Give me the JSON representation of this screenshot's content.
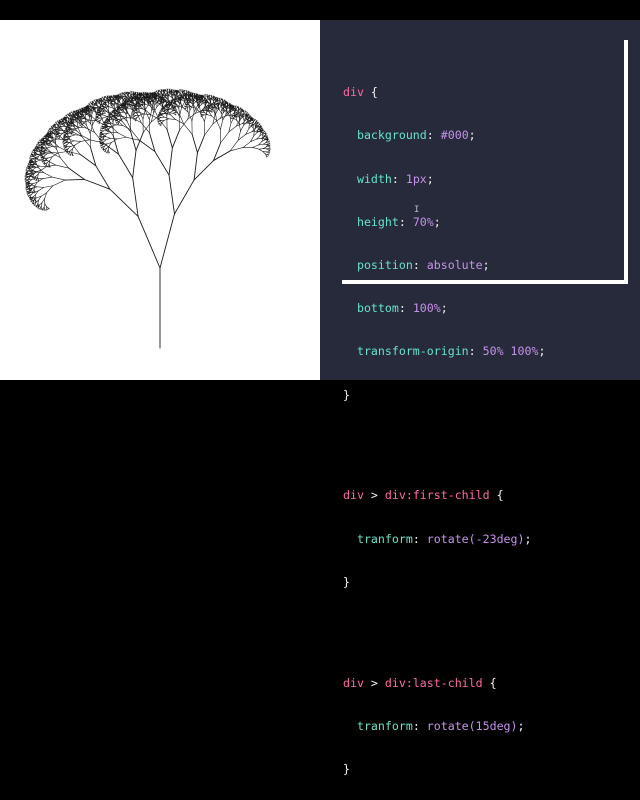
{
  "preview": {
    "tree": {
      "stroke": "#1a1a1a",
      "trunk_height_ratio": 0.7,
      "left_angle_deg": -23,
      "right_angle_deg": 15,
      "depth": 11
    }
  },
  "editor": {
    "theme": {
      "background": "#262a3a",
      "selector": "#ff6aa8",
      "property": "#67e3c8",
      "value": "#c792ea",
      "text": "#f2f2f2"
    },
    "rules": [
      {
        "selector": "div",
        "declarations": [
          {
            "property": "background",
            "value": "#000"
          },
          {
            "property": "width",
            "value": "1px"
          },
          {
            "property": "height",
            "value": "70%"
          },
          {
            "property": "position",
            "value": "absolute"
          },
          {
            "property": "bottom",
            "value": "100%"
          },
          {
            "property": "transform-origin",
            "value": "50% 100%"
          }
        ]
      },
      {
        "selector_parts": [
          "div",
          " > ",
          "div:first-child"
        ],
        "declarations": [
          {
            "property": "tranform",
            "value": "rotate(-23deg)"
          }
        ]
      },
      {
        "selector_parts": [
          "div",
          " > ",
          "div:last-child"
        ],
        "declarations": [
          {
            "property": "tranform",
            "value": "rotate(15deg)"
          }
        ]
      }
    ],
    "cursor_glyph": "I"
  }
}
